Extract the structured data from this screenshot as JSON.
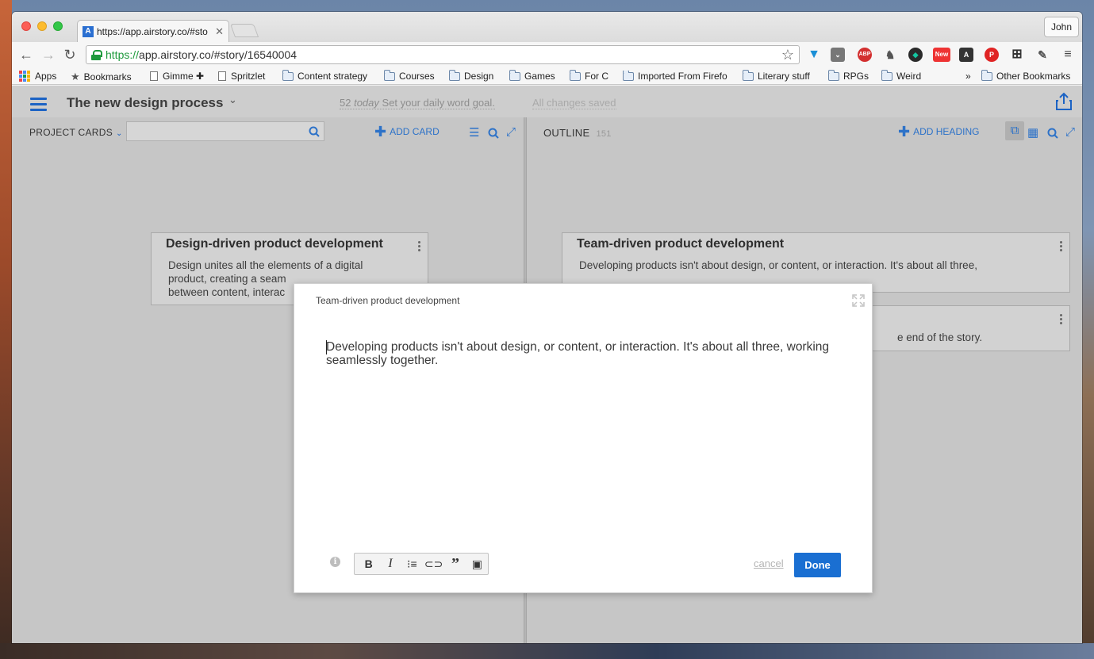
{
  "browser": {
    "tab_title": "https://app.airstory.co/#sto",
    "tab_favicon": "A",
    "profile_name": "John",
    "url_scheme": "https://",
    "url_rest": "app.airstory.co/#story/16540004",
    "extensions": [
      "vimeo-icon",
      "pocket-icon",
      "adblock-icon",
      "evernote-icon",
      "grammarly-icon",
      "new-badge-icon",
      "airstory-icon",
      "pinterest-icon",
      "grid-icon",
      "eyedropper-icon",
      "menu-icon"
    ],
    "ext_labels": {
      "adblock": "ABP",
      "new": "New",
      "a": "A"
    }
  },
  "bookmarks": {
    "items": [
      {
        "label": "Apps",
        "kind": "apps"
      },
      {
        "label": "Bookmarks",
        "kind": "star"
      },
      {
        "label": "Gimme ✚",
        "kind": "page"
      },
      {
        "label": "Spritzlet",
        "kind": "page"
      },
      {
        "label": "Content strategy",
        "kind": "folder"
      },
      {
        "label": "Courses",
        "kind": "folder"
      },
      {
        "label": "Design",
        "kind": "folder"
      },
      {
        "label": "Games",
        "kind": "folder"
      },
      {
        "label": "For C",
        "kind": "folder"
      },
      {
        "label": "Imported From Firefo",
        "kind": "folder"
      },
      {
        "label": "Literary stuff",
        "kind": "folder"
      },
      {
        "label": "RPGs",
        "kind": "folder"
      },
      {
        "label": "Weird",
        "kind": "folder"
      }
    ],
    "overflow": "»",
    "other": "Other Bookmarks"
  },
  "app": {
    "project_title": "The new design process",
    "word_count": "52",
    "word_today": "today",
    "word_goal_prompt": "Set your daily word goal.",
    "save_status": "All changes saved",
    "accent": "#2d72c8"
  },
  "left_pane": {
    "label": "PROJECT CARDS",
    "search_placeholder": "",
    "add_label": "ADD CARD",
    "card": {
      "title": "Design-driven product development",
      "body_lines": [
        "Design unites all the elements of a digital",
        "product, creating a seam",
        "between content, interac"
      ]
    }
  },
  "right_pane": {
    "label": "OUTLINE",
    "count": "151",
    "add_label": "ADD HEADING",
    "card1": {
      "title": "Team-driven product development",
      "body": "Developing products isn't about design, or content, or interaction. It's about all three,"
    },
    "card2": {
      "body_tail": "e end of the story."
    }
  },
  "modal": {
    "title": "Team-driven product development",
    "text": "Developing products isn't about design, or content, or interaction. It's about all three, working seamlessly together.",
    "format_buttons": [
      "B",
      "I",
      "list-icon",
      "link-icon",
      "quote-icon",
      "image-icon"
    ],
    "cancel": "cancel",
    "done": "Done",
    "done_color": "#1a6fd2"
  }
}
